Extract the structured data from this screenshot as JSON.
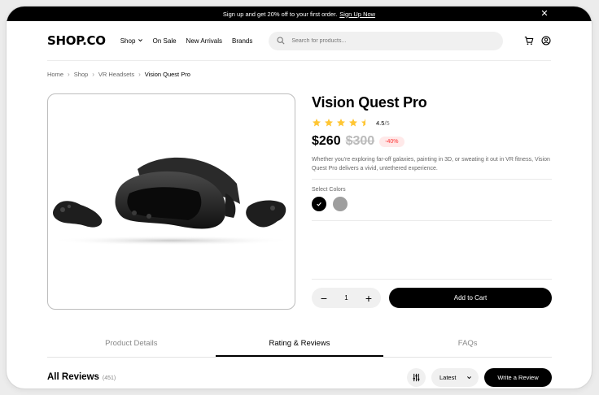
{
  "promo": {
    "text": "Sign up and get 20% off to your first order.",
    "link": "Sign Up Now"
  },
  "nav": {
    "logo": "SHOP.CO",
    "links": [
      "Shop",
      "On Sale",
      "New Arrivals",
      "Brands"
    ],
    "search_placeholder": "Search for products..."
  },
  "breadcrumb": [
    "Home",
    "Shop",
    "VR Headsets",
    "Vision Quest Pro"
  ],
  "product": {
    "title": "Vision Quest Pro",
    "rating": 4.5,
    "rating_value": "4.5",
    "rating_max": "/5",
    "price": "$260",
    "old_price": "$300",
    "discount": "-40%",
    "description": "Whether you're exploring far-off galaxies, painting in 3D, or sweating it out in VR fitness, Vision Quest Pro delivers a vivid, untethered experience.",
    "colors_label": "Select Colors",
    "colors": [
      "#000000",
      "#9e9e9e"
    ],
    "quantity": "1",
    "add_to_cart": "Add to Cart"
  },
  "tabs": [
    "Product Details",
    "Rating & Reviews",
    "FAQs"
  ],
  "reviews": {
    "title": "All Reviews",
    "count": "(451)",
    "sort": "Latest",
    "write": "Write a Review"
  },
  "colors": {
    "star": "#FFC633",
    "discount_bg": "#FFE9E9",
    "discount_text": "#FF3333"
  },
  "icons": [
    "close-icon",
    "chevron-down-icon",
    "search-icon",
    "cart-icon",
    "user-icon",
    "chevron-right-icon",
    "star-icon",
    "check-icon",
    "minus-icon",
    "plus-icon",
    "filter-icon"
  ]
}
